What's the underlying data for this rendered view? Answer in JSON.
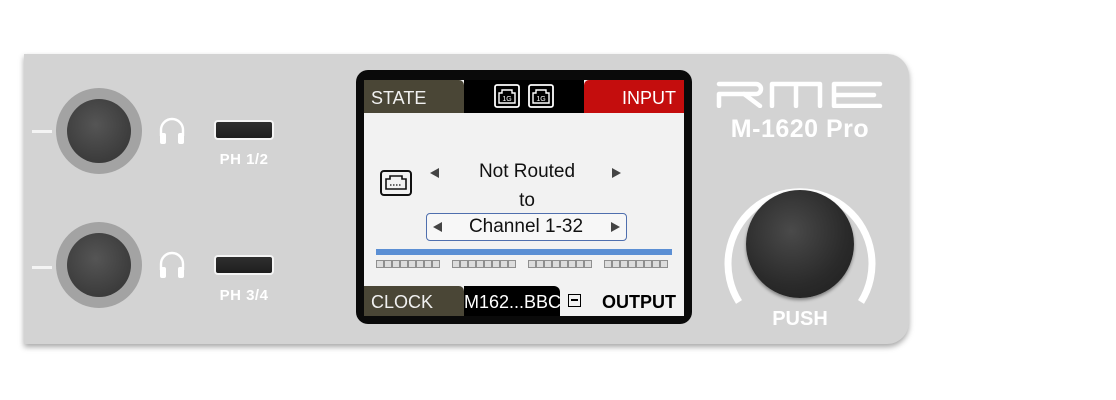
{
  "device": {
    "brand_logo": "RME",
    "model": "M-1620 Pro",
    "knob_label": "PUSH"
  },
  "headphones": [
    {
      "label": "PH 1/2",
      "icon": "headphones-icon"
    },
    {
      "label": "PH 3/4",
      "icon": "headphones-icon"
    }
  ],
  "display": {
    "header": {
      "left_tab": "STATE",
      "right_tab": "INPUT",
      "network_icons": [
        "1G",
        "1G"
      ]
    },
    "routing": {
      "source": "Not Routed",
      "connector": "to",
      "destination": "Channel 1-32"
    },
    "footer": {
      "left_tab": "CLOCK",
      "device_name": "M162...BBC",
      "right_tab": "OUTPUT"
    }
  },
  "colors": {
    "panel": "#d3d3d3",
    "input_tab": "#c40d0d",
    "state_tab": "#4a4636",
    "meter_bar": "#5b8fd4"
  }
}
